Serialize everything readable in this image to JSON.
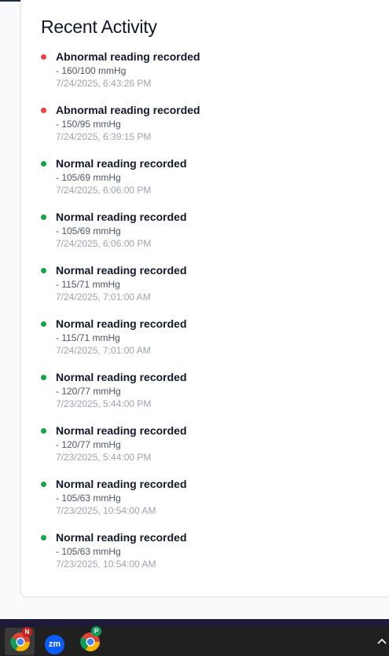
{
  "card": {
    "title": "Recent Activity"
  },
  "activities": [
    {
      "status": "abnormal",
      "title": "Abnormal reading recorded",
      "value": "- 160/100 mmHg",
      "time": "7/24/2025, 6:43:26 PM"
    },
    {
      "status": "abnormal",
      "title": "Abnormal reading recorded",
      "value": "- 150/95 mmHg",
      "time": "7/24/2025, 6:39:15 PM"
    },
    {
      "status": "normal",
      "title": "Normal reading recorded",
      "value": "- 105/69 mmHg",
      "time": "7/24/2025, 6:06:00 PM"
    },
    {
      "status": "normal",
      "title": "Normal reading recorded",
      "value": "- 105/69 mmHg",
      "time": "7/24/2025, 6:06:00 PM"
    },
    {
      "status": "normal",
      "title": "Normal reading recorded",
      "value": "- 115/71 mmHg",
      "time": "7/24/2025, 7:01:00 AM"
    },
    {
      "status": "normal",
      "title": "Normal reading recorded",
      "value": "- 115/71 mmHg",
      "time": "7/24/2025, 7:01:00 AM"
    },
    {
      "status": "normal",
      "title": "Normal reading recorded",
      "value": "- 120/77 mmHg",
      "time": "7/23/2025, 5:44:00 PM"
    },
    {
      "status": "normal",
      "title": "Normal reading recorded",
      "value": "- 120/77 mmHg",
      "time": "7/23/2025, 5:44:00 PM"
    },
    {
      "status": "normal",
      "title": "Normal reading recorded",
      "value": "- 105/63 mmHg",
      "time": "7/23/2025, 10:54:00 AM"
    },
    {
      "status": "normal",
      "title": "Normal reading recorded",
      "value": "- 105/63 mmHg",
      "time": "7/23/2025, 10:54:00 AM"
    }
  ],
  "colors": {
    "abnormal": "#ef4444",
    "normal": "#16a34a"
  },
  "taskbar": {
    "icons": [
      {
        "name": "chrome-icon",
        "badge": "N"
      },
      {
        "name": "zoom-icon",
        "label": "zm"
      },
      {
        "name": "chrome-icon",
        "badge": "P"
      }
    ],
    "tray_chevron": "^"
  }
}
